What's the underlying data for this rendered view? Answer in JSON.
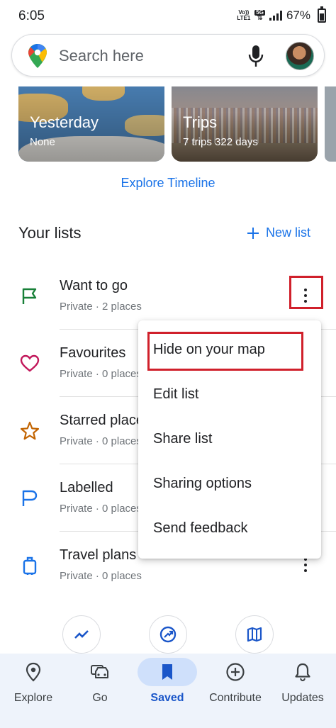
{
  "status_bar": {
    "time": "6:05",
    "network_tag_top": "Vo))",
    "network_tag_bottom": "LTE1",
    "network_5g": "5G",
    "battery_pct": "67%"
  },
  "search": {
    "placeholder": "Search here"
  },
  "cards": [
    {
      "title": "Yesterday",
      "subtitle": "None"
    },
    {
      "title": "Trips",
      "subtitle": "7 trips  322 days"
    }
  ],
  "explore_timeline": "Explore Timeline",
  "lists": {
    "heading": "Your lists",
    "new_list": "New list",
    "items": [
      {
        "title": "Want to go",
        "meta": "Private · 2 places",
        "icon": "flag-icon"
      },
      {
        "title": "Favourites",
        "meta": "Private · 0 places",
        "icon": "heart-icon"
      },
      {
        "title": "Starred places",
        "meta": "Private · 0 places",
        "icon": "star-icon"
      },
      {
        "title": "Labelled",
        "meta": "Private · 0 places",
        "icon": "label-flag-icon"
      },
      {
        "title": "Travel plans",
        "meta": "Private · 0 places",
        "icon": "suitcase-icon"
      }
    ]
  },
  "menu": {
    "items": [
      "Hide on your map",
      "Edit list",
      "Share list",
      "Sharing options",
      "Send feedback"
    ]
  },
  "bottom_nav": {
    "items": [
      {
        "label": "Explore",
        "icon": "location-pin-icon"
      },
      {
        "label": "Go",
        "icon": "car-icon"
      },
      {
        "label": "Saved",
        "icon": "bookmark-icon",
        "active": true
      },
      {
        "label": "Contribute",
        "icon": "add-circle-icon"
      },
      {
        "label": "Updates",
        "icon": "bell-icon"
      }
    ]
  },
  "colors": {
    "accent": "#1a73e8",
    "highlight_border": "#d0202b",
    "flag_green": "#188038",
    "heart_pink": "#c2185b",
    "star_orange": "#c26401",
    "label_blue": "#1a73e8",
    "nav_bg": "#eef3fb"
  }
}
